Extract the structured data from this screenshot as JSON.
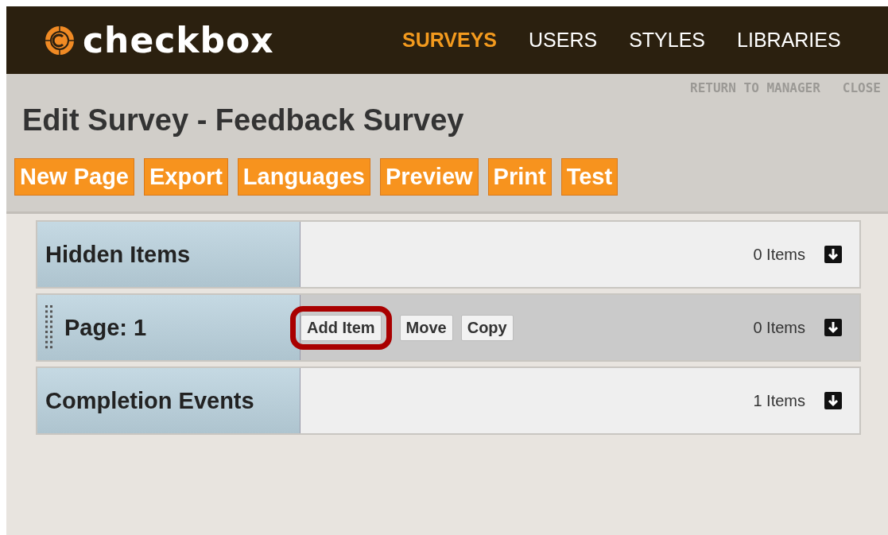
{
  "header": {
    "logo_text": "checkbox",
    "nav": [
      {
        "label": "SURVEYS",
        "selected": true
      },
      {
        "label": "USERS",
        "selected": false
      },
      {
        "label": "STYLES",
        "selected": false
      },
      {
        "label": "LIBRARIES",
        "selected": false
      }
    ]
  },
  "top_links": [
    "RETURN TO MANAGER",
    "CLOSE"
  ],
  "title": "Edit Survey - Feedback Survey",
  "toolbar": [
    "New Page",
    "Export",
    "Languages",
    "Preview",
    "Print",
    "Test"
  ],
  "sections": [
    {
      "title": "Hidden Items",
      "kind": "fixed",
      "count": "0 Items"
    },
    {
      "title": "Page: 1",
      "kind": "page",
      "count": "0 Items",
      "buttons": [
        {
          "label": "Add Item",
          "highlighted": true
        },
        {
          "label": "Move",
          "highlighted": false
        },
        {
          "label": "Copy",
          "highlighted": false
        }
      ]
    },
    {
      "title": "Completion Events",
      "kind": "fixed",
      "count": "1 Items"
    }
  ]
}
